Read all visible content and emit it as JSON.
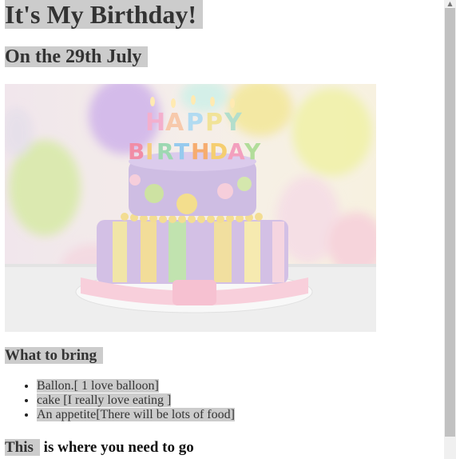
{
  "page": {
    "title": "It's My Birthday!",
    "subtitle": "On the 29th July",
    "image_alt": "Birthday cake",
    "bring_heading": "What to bring",
    "bring_items": [
      "Ballon.[ 1 love balloon]",
      "cake [I really love eating ]",
      "An appetite[There will be lots of food]"
    ],
    "go_heading_highlight": "This",
    "go_heading_rest": " is where you need to go"
  },
  "colors": {
    "highlight": "#cccccc",
    "background": "#ffffff"
  }
}
